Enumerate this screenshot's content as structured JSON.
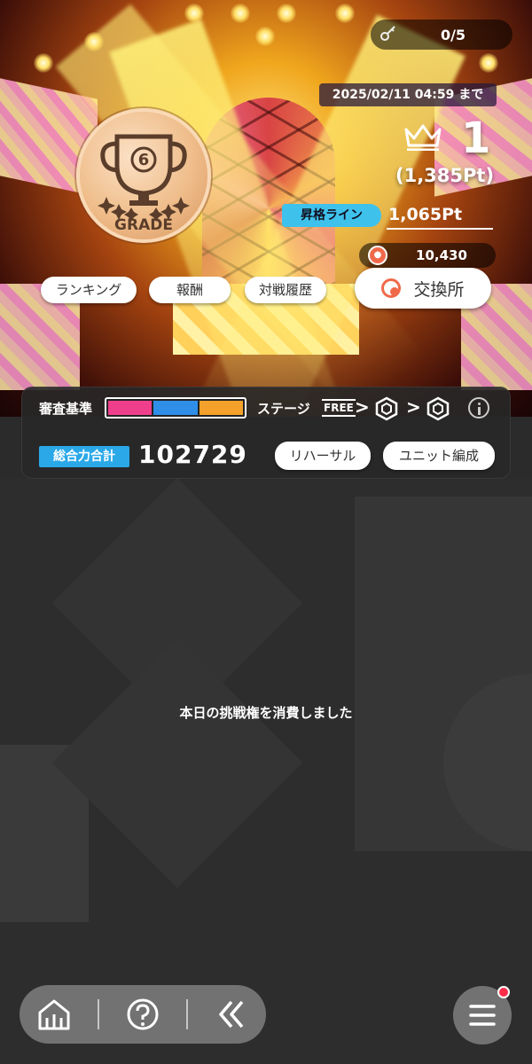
{
  "header": {
    "challenge_count": "0/5",
    "deadline": "2025/02/11 04:59 まで"
  },
  "grade": {
    "number": "6",
    "label": "GRADE"
  },
  "rank": {
    "position": "1",
    "points": "(1,385Pt)",
    "promotion_label": "昇格ライン",
    "promotion_value": "1,065Pt"
  },
  "currency": {
    "value": "10,430"
  },
  "buttons": {
    "ranking": "ランキング",
    "reward": "報酬",
    "battle_history": "対戦履歴",
    "exchange": "交換所",
    "rehearsal": "リハーサル",
    "unit_formation": "ユニット編成"
  },
  "criteria": {
    "label": "審査基準",
    "colors": [
      "#ef3f8c",
      "#2f8ee8",
      "#f3a12a"
    ],
    "stage_label": "ステージ",
    "free_label": "FREE"
  },
  "total": {
    "label": "総合力合計",
    "value": "102729"
  },
  "message": "本日の挑戦権を消費しました",
  "nav": {
    "icons": [
      "home-icon",
      "help-icon",
      "back-icon",
      "menu-icon"
    ]
  }
}
